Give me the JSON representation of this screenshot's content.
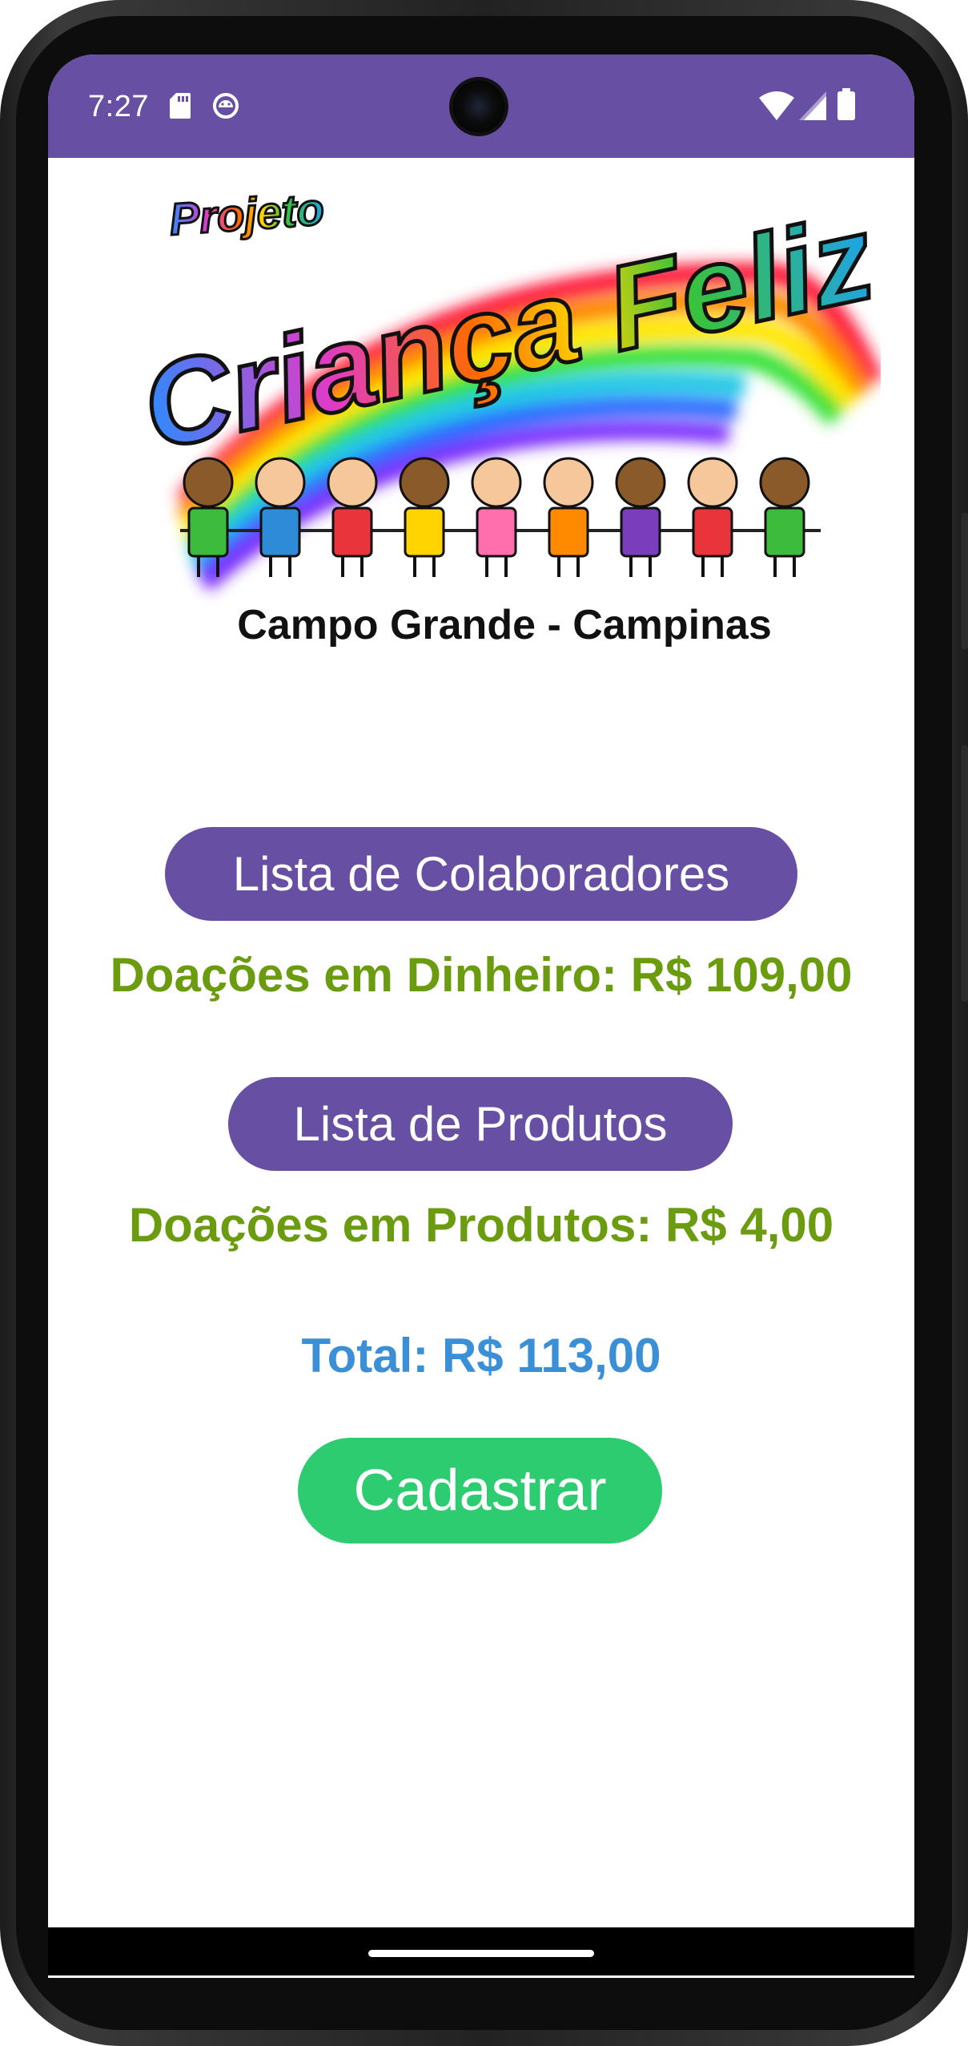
{
  "status_bar": {
    "time": "7:27",
    "icons_left": [
      "sd-card-icon",
      "android-debug-icon"
    ],
    "icons_right": [
      "wifi-icon",
      "cell-signal-icon",
      "battery-icon"
    ]
  },
  "banner": {
    "logo_projeto": "Projeto",
    "logo_title": "Criança Feliz",
    "logo_subtitle": "Campo Grande - Campinas"
  },
  "main": {
    "colaboradores_button": "Lista de Colaboradores",
    "doacoes_dinheiro": "Doações em Dinheiro: R$ 109,00",
    "produtos_button": "Lista de Produtos",
    "doacoes_produtos": "Doações em Produtos: R$ 4,00",
    "total": "Total: R$ 113,00",
    "cadastrar_button": "Cadastrar"
  },
  "colors": {
    "primary": "#6750A4",
    "donation_text": "#6B9B0F",
    "total_text": "#3A8FD6",
    "cadastrar_button": "#2ECC71"
  }
}
